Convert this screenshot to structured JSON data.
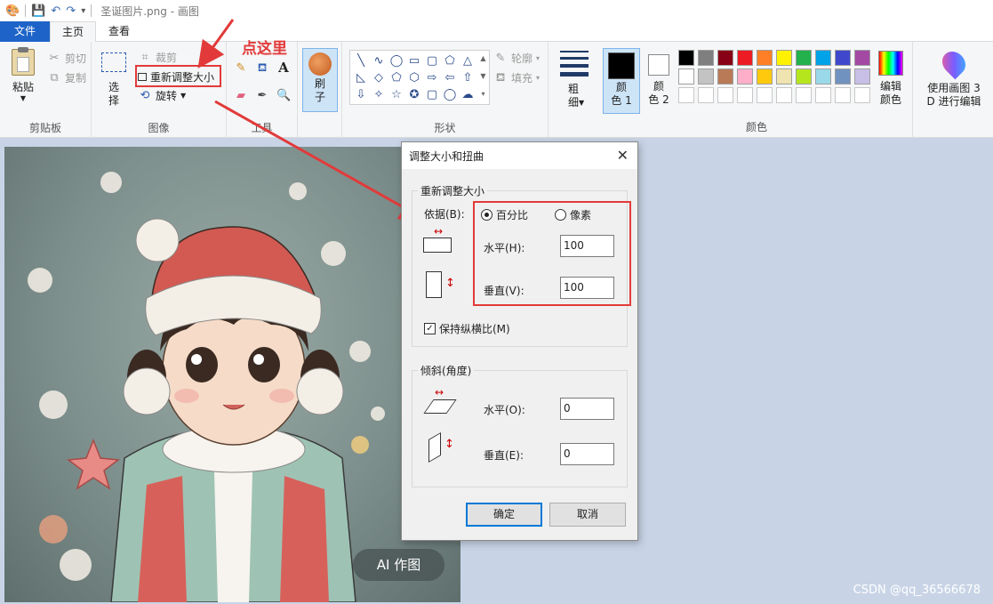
{
  "window": {
    "title": "圣诞图片.png - 画图"
  },
  "tabs": {
    "file": "文件",
    "home": "主页",
    "view": "查看"
  },
  "clipboard": {
    "paste": "粘贴",
    "cut": "剪切",
    "copy": "复制",
    "label": "剪贴板"
  },
  "image": {
    "select": "选\n择",
    "crop": "裁剪",
    "resize": "重新调整大小",
    "rotate": "旋转",
    "label": "图像"
  },
  "tools": {
    "label": "工具"
  },
  "brush": {
    "label": "刷\n子"
  },
  "shapes": {
    "outline": "轮廓",
    "fill": "填充",
    "label": "形状",
    "glyphs": [
      "╲",
      "∿",
      "◯",
      "▭",
      "▢",
      "⬠",
      "△",
      "◺",
      "◇",
      "⬠",
      "⬡",
      "⇨",
      "⇦",
      "⇧",
      "⇩",
      "✧",
      "☆",
      "✪",
      "▢",
      "◯",
      "☁"
    ]
  },
  "size": {
    "label": "粗\n细"
  },
  "color1": {
    "label": "颜\n色 1"
  },
  "color2": {
    "label": "颜\n色 2"
  },
  "edit_colors": {
    "label": "编辑\n颜色"
  },
  "paint3d": {
    "label": "使用画图 3\nD 进行编辑"
  },
  "colors": {
    "label": "颜色",
    "row1": [
      "#000000",
      "#7f7f7f",
      "#880015",
      "#ed1c24",
      "#ff7f27",
      "#fff200",
      "#22b14c",
      "#00a2e8",
      "#3f48cc",
      "#a349a4"
    ],
    "row2": [
      "#ffffff",
      "#c3c3c3",
      "#b97a57",
      "#ffaec9",
      "#ffc90e",
      "#efe4b0",
      "#b5e61d",
      "#99d9ea",
      "#7092be",
      "#c8bfe7"
    ]
  },
  "annotation": {
    "click_here": "点这里"
  },
  "canvas": {
    "badge": "AI 作图"
  },
  "dialog": {
    "title": "调整大小和扭曲",
    "resize_group": "重新调整大小",
    "by": "依据(B):",
    "percent": "百分比",
    "pixels": "像素",
    "horizontal": "水平(H):",
    "vertical": "垂直(V):",
    "h_value": "100",
    "v_value": "100",
    "keep_ratio": "保持纵横比(M)",
    "skew_group": "倾斜(角度)",
    "skew_h": "水平(O):",
    "skew_v": "垂直(E):",
    "skew_h_value": "0",
    "skew_v_value": "0",
    "ok": "确定",
    "cancel": "取消"
  },
  "watermark": "CSDN @qq_36566678"
}
